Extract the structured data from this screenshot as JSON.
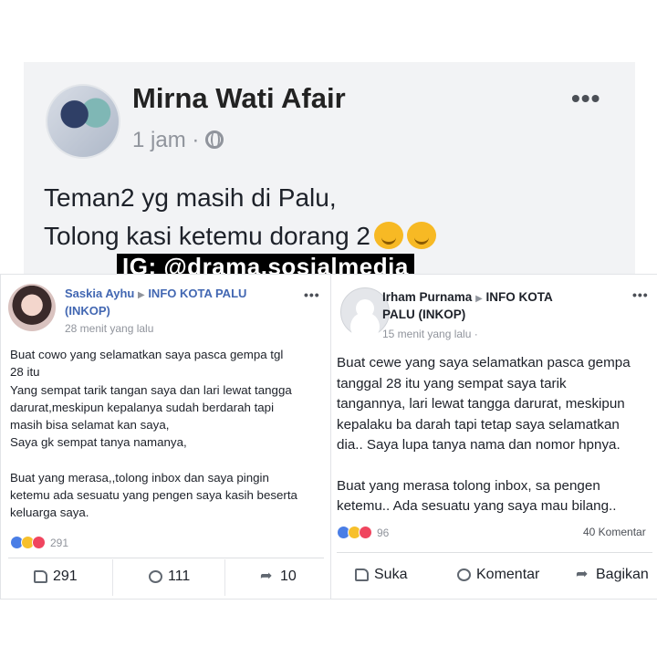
{
  "top_post": {
    "author": "Mirna Wati Afair",
    "time": "1 jam ·",
    "text_line1": "Teman2 yg masih di Palu,",
    "text_line2": "Tolong kasi ketemu dorang 2",
    "menu": "•••"
  },
  "watermark": "IG: @drama.sosialmedia",
  "left_post": {
    "author": "Saskia Ayhu",
    "group": "INFO KOTA PALU",
    "group_sub": "(INKOP)",
    "time": "28 menit yang lalu",
    "menu": "•••",
    "body_lines": [
      "Buat cowo yang selamatkan saya pasca gempa tgl",
      "28 itu",
      "Yang sempat tarik tangan saya dan lari lewat tangga",
      "darurat,meskipun kepalanya sudah berdarah tapi",
      "masih bisa selamat kan saya,",
      "Saya gk sempat tanya namanya,",
      "",
      "Buat yang merasa,,tolong inbox dan saya pingin",
      "ketemu ada sesuatu yang pengen saya kasih beserta",
      "keluarga saya."
    ],
    "reaction_count": "291",
    "actions": {
      "like": "291",
      "comment": "111",
      "share": "10"
    }
  },
  "right_post": {
    "author": "Irham Purnama",
    "group": "INFO KOTA",
    "group_sub": "PALU (INKOP)",
    "time": "15 menit yang lalu ·",
    "menu": "•••",
    "body_lines": [
      "Buat cewe yang saya selamatkan pasca gempa",
      "tanggal 28 itu yang sempat saya tarik",
      "tangannya, lari lewat tangga darurat, meskipun",
      "kepalaku ba darah tapi tetap saya selamatkan",
      "dia.. Saya lupa tanya nama dan nomor hpnya.",
      "",
      "Buat yang merasa tolong inbox, sa pengen",
      "ketemu.. Ada sesuatu yang saya mau bilang.."
    ],
    "reaction_count": "96",
    "comments": "40 Komentar",
    "actions": {
      "like": "Suka",
      "comment": "Komentar",
      "share": "Bagikan"
    }
  },
  "colors": {
    "facebook_blue": "#4267b2",
    "gray_text": "#90949c",
    "card_bg": "#f2f3f5"
  }
}
